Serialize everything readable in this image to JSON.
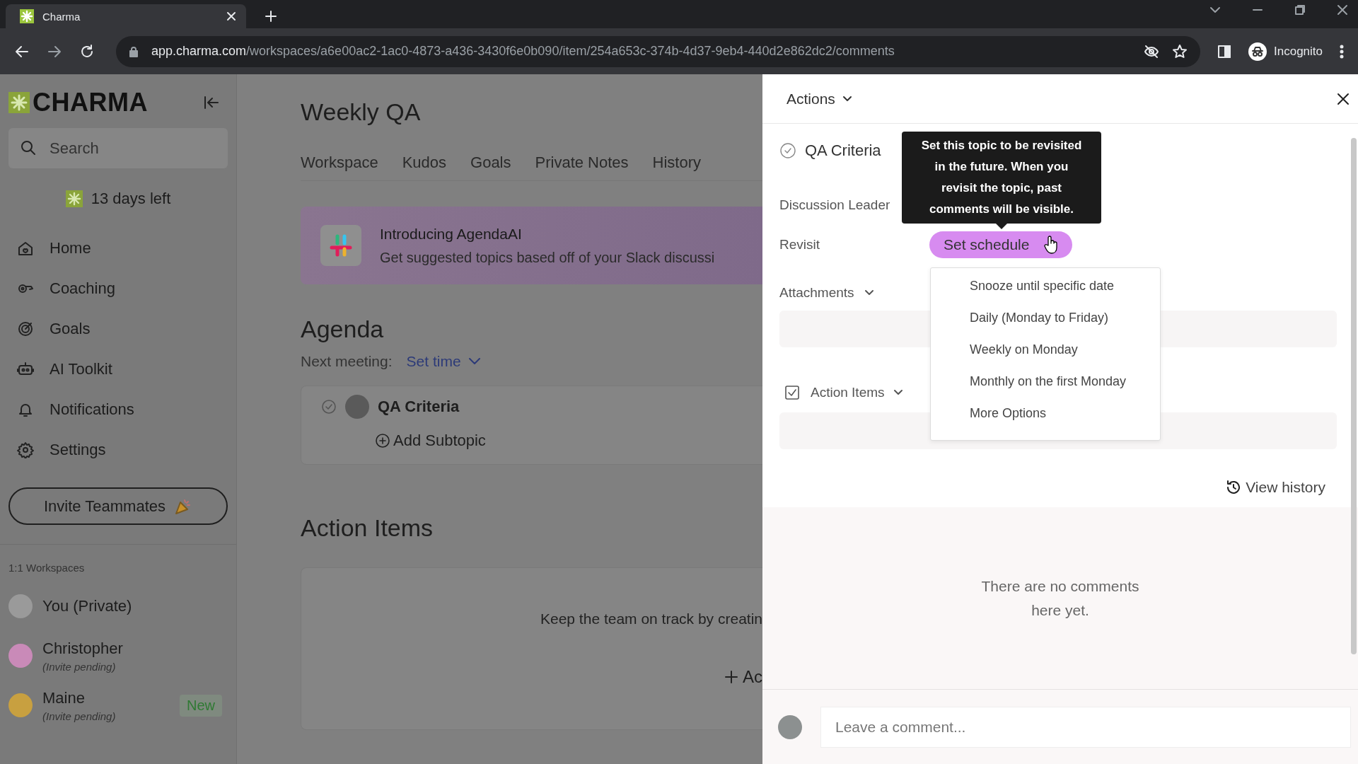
{
  "browser": {
    "tab_title": "Charma",
    "url_host": "app.charma.com",
    "url_path": "/workspaces/a6e00ac2-1ac0-4873-a436-3430f6e0b090/item/254a653c-374b-4d37-9eb4-440d2e862dc2/comments",
    "profile": "Incognito"
  },
  "sidebar": {
    "logo": "CHARMA",
    "search": {
      "placeholder": "Search"
    },
    "trial": "13 days left",
    "items": [
      {
        "label": "Home",
        "kind": "home"
      },
      {
        "label": "Coaching",
        "kind": "coaching"
      },
      {
        "label": "Goals",
        "kind": "goals"
      },
      {
        "label": "AI Toolkit",
        "kind": "robot"
      },
      {
        "label": "Notifications",
        "kind": "bell"
      },
      {
        "label": "Settings",
        "kind": "gear"
      }
    ],
    "invite_button": "Invite Teammates",
    "section": "1:1 Workspaces",
    "workspaces": [
      {
        "name": "You (Private)",
        "color": "#9a9a9a"
      },
      {
        "name": "Christopher",
        "subtitle": "(Invite pending)",
        "color": "#c98ab8"
      },
      {
        "name": "Maine",
        "subtitle": "(Invite pending)",
        "color": "#c8a040",
        "badge": "New"
      }
    ]
  },
  "main": {
    "title": "Weekly QA",
    "tabs": [
      "Workspace",
      "Kudos",
      "Goals",
      "Private Notes",
      "History"
    ],
    "banner": {
      "title": "Introducing AgendaAI",
      "text": "Get suggested topics based off of your Slack discussi"
    },
    "agenda": {
      "heading": "Agenda",
      "next_label": "Next meeting:",
      "next_value": "Set time",
      "topic": "QA Criteria",
      "add_subtopic": "Add Subtopic"
    },
    "action_items": {
      "heading": "Action Items",
      "empty_text": "Keep the team on track by creatin",
      "add": "Ac"
    }
  },
  "panel": {
    "actions": "Actions",
    "topic": "QA Criteria",
    "leader_label": "Discussion Leader",
    "revisit_label": "Revisit",
    "schedule_button": "Set schedule",
    "tooltip": "Set this topic to be revisited in the future. When you revisit the topic, past comments will be visible.",
    "attachments": "Attachments",
    "action_items": {
      "label": "Action Items",
      "checked": true
    },
    "menu": [
      "Snooze until specific date",
      "Daily (Monday to Friday)",
      "Weekly on Monday",
      "Monthly on the first Monday",
      "More Options"
    ],
    "view_history": "View history",
    "empty_comments": "There are no comments here yet.",
    "comment": {
      "placeholder": "Leave a comment..."
    }
  }
}
